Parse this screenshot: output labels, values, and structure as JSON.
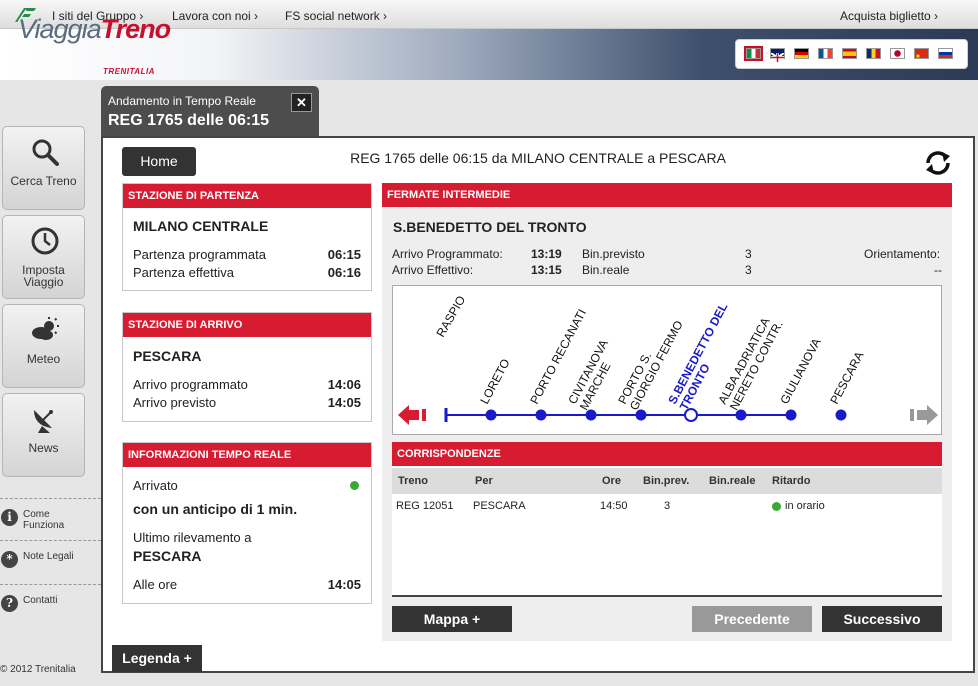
{
  "topnav": {
    "links": [
      "I siti del Gruppo ›",
      "Lavora con noi ›",
      "FS social network ›"
    ],
    "right_link": "Acquista biglietto ›"
  },
  "header": {
    "logo_part1": "Viaggia",
    "logo_part2": "Treno",
    "logo_sub": "TRENITALIA",
    "languages": [
      "it",
      "en",
      "de",
      "fr",
      "es",
      "ro",
      "ja",
      "zh",
      "ru"
    ]
  },
  "sidebar": {
    "buttons": [
      {
        "label": "Cerca Treno",
        "icon": "search-icon"
      },
      {
        "label": "Imposta Viaggio",
        "icon": "clock-icon"
      },
      {
        "label": "Meteo",
        "icon": "weather-icon"
      },
      {
        "label": "News",
        "icon": "satellite-dish-icon"
      }
    ],
    "links": [
      {
        "label": "Come Funziona",
        "icon": "info-icon"
      },
      {
        "label": "Note Legali",
        "icon": "asterisk-icon"
      },
      {
        "label": "Contatti",
        "icon": "help-icon"
      }
    ],
    "copyright": "© 2012 Trenitalia"
  },
  "tab": {
    "subtitle": "Andamento in Tempo Reale",
    "title": "REG 1765 delle 06:15",
    "close": "✕"
  },
  "main": {
    "home_label": "Home",
    "route_title": "REG 1765 delle 06:15 da MILANO CENTRALE a PESCARA",
    "departure": {
      "header": "STAZIONE DI PARTENZA",
      "station": "MILANO CENTRALE",
      "rows": [
        {
          "label": "Partenza programmata",
          "value": "06:15"
        },
        {
          "label": "Partenza effettiva",
          "value": "06:16"
        }
      ]
    },
    "arrival": {
      "header": "STAZIONE DI ARRIVO",
      "station": "PESCARA",
      "rows": [
        {
          "label": "Arrivo programmato",
          "value": "14:06"
        },
        {
          "label": "Arrivo previsto",
          "value": "14:05"
        }
      ]
    },
    "realtime": {
      "header": "INFORMAZIONI TEMPO REALE",
      "status": "Arrivato",
      "status_color": "#3aa835",
      "delay": "con un anticipo di 1 min.",
      "last_detect_label": "Ultimo rilevamento a",
      "last_station": "PESCARA",
      "time_label": "Alle ore",
      "time_value": "14:05"
    },
    "stops": {
      "header": "FERMATE INTERMEDIE",
      "current_station": "S.BENEDETTO DEL TRONTO",
      "arr_prog_label": "Arrivo Programmato:",
      "arr_prog_value": "13:19",
      "arr_eff_label": "Arrivo Effettivo:",
      "arr_eff_value": "13:15",
      "bin_prev_label": "Bin.previsto",
      "bin_prev_value": "3",
      "bin_real_label": "Bin.reale",
      "bin_real_value": "3",
      "orient_label": "Orientamento:",
      "orient_value": "--",
      "cut_label": "RASPIO",
      "line_stations": [
        {
          "name": "LORETO"
        },
        {
          "name": "PORTO RECANATI"
        },
        {
          "name": "CIVITANOVA MARCHE"
        },
        {
          "name": "PORTO S. GIORGIO FERMO"
        },
        {
          "name": "S.BENEDETTO DEL TRONTO",
          "current": true
        },
        {
          "name": "ALBA ADRIATICA NERETO CONTR."
        },
        {
          "name": "GIULIANOVA"
        },
        {
          "name": "PESCARA"
        }
      ],
      "line_color": "#1a1ac8"
    },
    "connections": {
      "header": "CORRISPONDENZE",
      "columns": [
        "Treno",
        "Per",
        "Ore",
        "Bin.prev.",
        "Bin.reale",
        "Ritardo"
      ],
      "rows": [
        {
          "treno": "REG 12051",
          "per": "PESCARA",
          "ore": "14:50",
          "bin_prev": "3",
          "bin_reale": "",
          "ritardo": "in orario"
        }
      ]
    },
    "buttons": {
      "mappa": "Mappa +",
      "precedente": "Precedente",
      "successivo": "Successivo",
      "legenda": "Legenda +"
    },
    "accent_color": "#d71b30"
  }
}
